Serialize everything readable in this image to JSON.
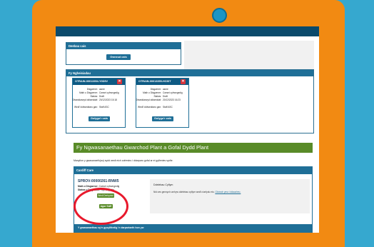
{
  "colors": {
    "frame": "#f28a12",
    "background": "#36a8cf",
    "header_blue": "#1f6f97",
    "green": "#598b28",
    "delete_red": "#d4333b",
    "highlight": "#e8192c"
  },
  "codes_panel": {
    "title": "Deebau cais",
    "button": "Gwneud cais"
  },
  "applications": {
    "title": "Fy Ngheisiadau",
    "cards": [
      {
        "ref": "OTRAIN-00013354-Y0D5V",
        "delete_icon": "trash-icon",
        "rows": [
          [
            "Disgwrner:",
            "asme"
          ],
          [
            "Math o Disgwrner:",
            "Cwrsei cyfrwngedig"
          ],
          [
            "Statws:",
            "Draft"
          ],
          [
            "Diweddarwyd ddiweddaf:",
            "20/12/2023 15:18"
          ],
          [
            "Wedi'i ddiweddaru gan:",
            "Staff ASC"
          ]
        ],
        "button": "Golygu'r cais"
      },
      {
        "ref": "OTRAIN-00013355-HCIDT",
        "delete_icon": "trash-icon",
        "rows": [
          [
            "Disgwrner:",
            "asme"
          ],
          [
            "Math o Disgwrner:",
            "Cwrsei cyfrwngedig"
          ],
          [
            "Statws:",
            "Draft"
          ],
          [
            "Diweddarwyd ddiweddaf:",
            "20/12/2023 16:23"
          ],
          [
            "Wedi'i ddiweddaru gan:",
            "Staff ASC"
          ]
        ],
        "button": "Golygu'r cais"
      }
    ]
  },
  "services": {
    "title": "Fy Ngwasanaethau Gwarchod Plant a Gofal Dydd Plant",
    "intro": "Manylion y gwasanaeth(au) sydd wedi eich cofrestru i ddarparu gofal ar ei gyflenies sydhr.",
    "panel_title": "Cardiff Care",
    "service_ref": "SPROV-00000261-RNW5",
    "type_label": "Math o Disgwrner:",
    "type_value": "Cwrsei cyfrwngedig",
    "status_label": "Statws y Disgwrner:",
    "status_value": "Cyfrwngedig",
    "status_badge": "Wedi Derbyniol",
    "open_button": "Agor SAE",
    "deeds_title": "Ddelebau Cyflym",
    "deeds_text": "Nid oes gennych unrhyw ddelebau cyflym wedi'u tarfydu eto.",
    "deeds_link": "Cliciwch yma i ddaucheu.",
    "footer_bar": "Y gwasanaethau sy'n gysylltiedig 'n darpariaeth hon yw"
  }
}
